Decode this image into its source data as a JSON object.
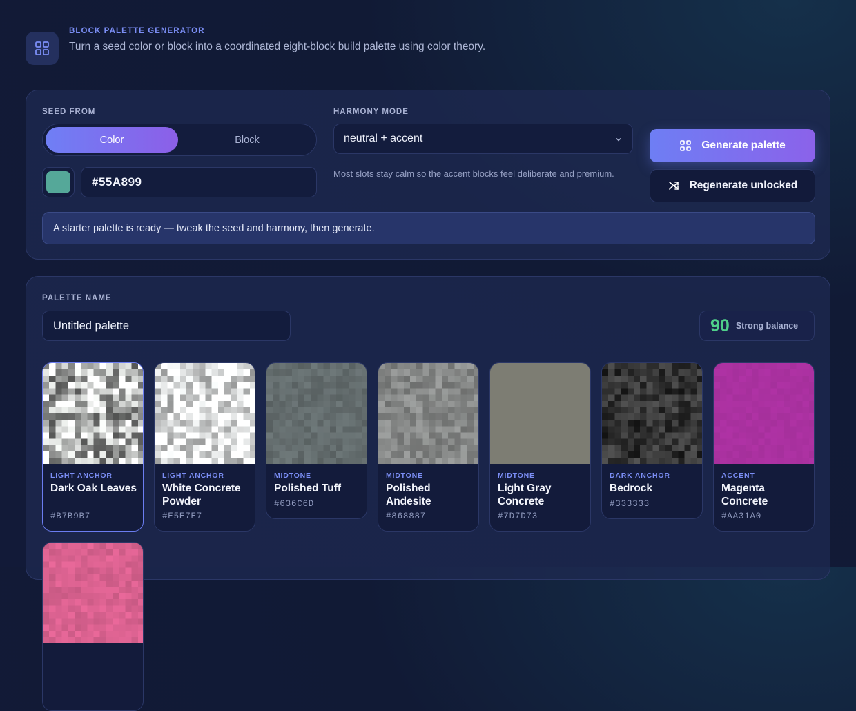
{
  "header": {
    "eyebrow": "BLOCK PALETTE GENERATOR",
    "subtitle": "Turn a seed color or block into a coordinated eight-block build palette using color theory.",
    "logo_icon": "grid-icon"
  },
  "seed": {
    "label": "SEED FROM",
    "options": [
      "Color",
      "Block"
    ],
    "selected": "Color",
    "hex_value": "#55A899",
    "swatch_color": "#55A899"
  },
  "harmony": {
    "label": "HARMONY MODE",
    "value": "neutral + accent",
    "help": "Most slots stay calm so the accent blocks feel deliberate and premium."
  },
  "actions": {
    "generate": "Generate palette",
    "regenerate": "Regenerate unlocked"
  },
  "status": "A starter palette is ready — tweak the seed and harmony, then generate.",
  "palette": {
    "name_label": "PALETTE NAME",
    "name_value": "Untitled palette",
    "score": "90",
    "score_label": "Strong balance",
    "blocks": [
      {
        "role": "LIGHT ANCHOR",
        "name": "Dark Oak Leaves",
        "hex": "#B7B9B7",
        "color": "#B7B9B7"
      },
      {
        "role": "LIGHT ANCHOR",
        "name": "White Concrete Powder",
        "hex": "#E5E7E7",
        "color": "#E5E7E7"
      },
      {
        "role": "MIDTONE",
        "name": "Polished Tuff",
        "hex": "#636C6D",
        "color": "#636C6D"
      },
      {
        "role": "MIDTONE",
        "name": "Polished Andesite",
        "hex": "#868887",
        "color": "#868887"
      },
      {
        "role": "MIDTONE",
        "name": "Light Gray Concrete",
        "hex": "#7D7D73",
        "color": "#7D7D73"
      },
      {
        "role": "DARK ANCHOR",
        "name": "Bedrock",
        "hex": "#333333",
        "color": "#333333"
      },
      {
        "role": "ACCENT",
        "name": "Magenta Concrete",
        "hex": "#AA31A0",
        "color": "#AA31A0"
      },
      {
        "color": "#D9618F"
      }
    ]
  },
  "colors": {
    "accent": "#7B8EF5",
    "score": "#4FD08A"
  }
}
